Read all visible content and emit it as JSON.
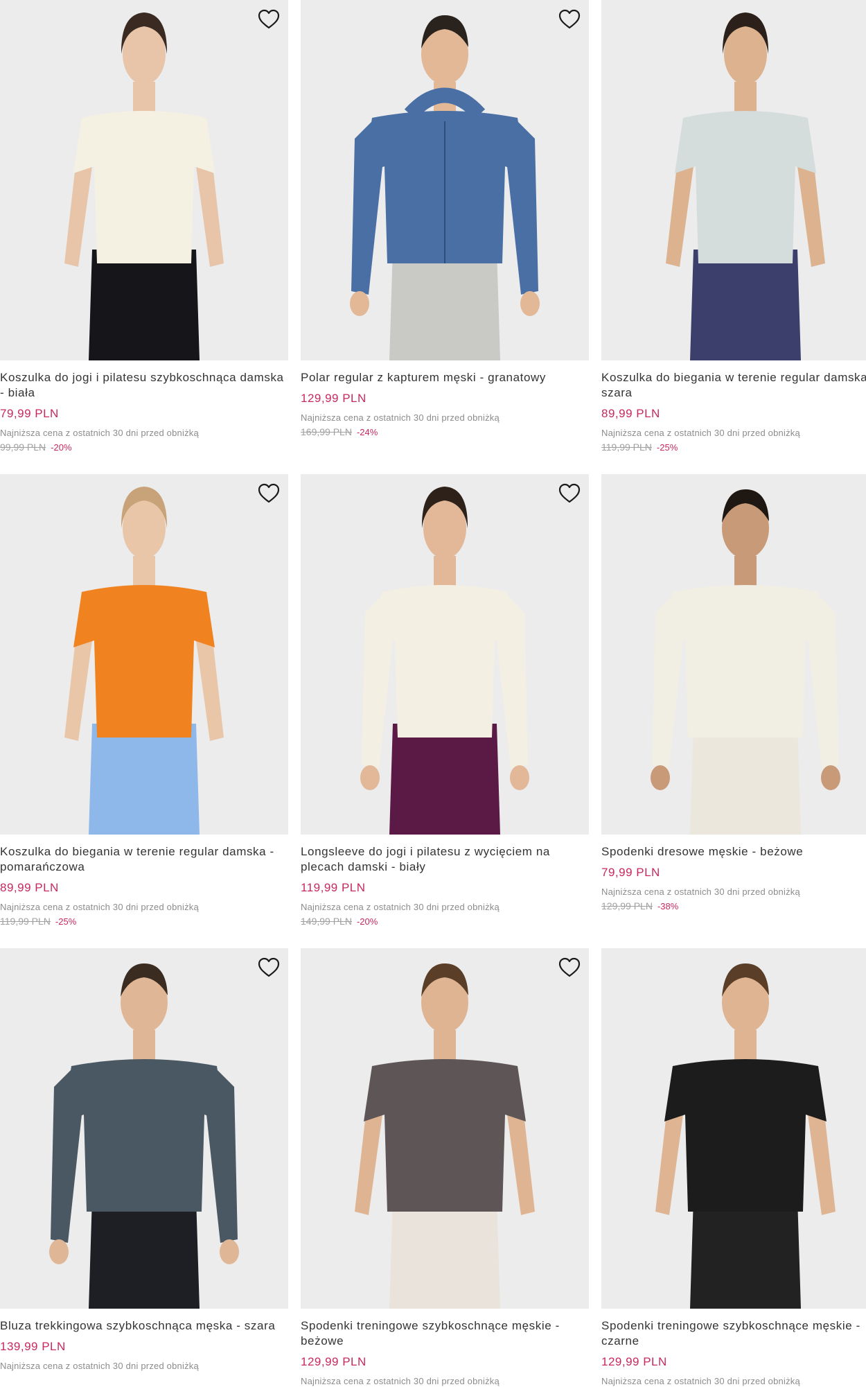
{
  "colors": {
    "price": "#c8285e",
    "image_background": "#ececec",
    "text": "#333333",
    "muted": "#8c8c8c"
  },
  "icons": {
    "favorite": "heart-outline-icon"
  },
  "products": [
    {
      "name": "Koszulka do jogi i pilatesu szybkoschnąca damska - biała",
      "price": "79,99 PLN",
      "lowest_label": "Najniższa cena z ostatnich 30 dni przed obniżką",
      "old_price": "99,99 PLN",
      "discount": "-20%",
      "look": {
        "top": "#f5f1e2",
        "bottom": "#15151a",
        "skin": "#e8c4a8",
        "hair": "#3a2a22",
        "sleeve": "short",
        "gender": "f"
      }
    },
    {
      "name": "Polar regular z kapturem męski - granatowy",
      "price": "129,99 PLN",
      "lowest_label": "Najniższa cena z ostatnich 30 dni przed obniżką",
      "old_price": "169,99 PLN",
      "discount": "-24%",
      "look": {
        "top": "#4a6fa5",
        "bottom": "#c9c9c6",
        "skin": "#e2b896",
        "hair": "#2a221c",
        "sleeve": "hoodie",
        "gender": "m"
      }
    },
    {
      "name": "Koszulka do biegania w terenie regular damska - szara",
      "price": "89,99 PLN",
      "lowest_label": "Najniższa cena z ostatnich 30 dni przed obniżką",
      "old_price": "119,99 PLN",
      "discount": "-25%",
      "look": {
        "top": "#d5dcdc",
        "bottom": "#3c3f6b",
        "skin": "#dcb28f",
        "hair": "#2c211a",
        "sleeve": "short",
        "gender": "f"
      }
    },
    {
      "name": "Koszulka do biegania w terenie regular damska - pomarańczowa",
      "price": "89,99 PLN",
      "lowest_label": "Najniższa cena z ostatnich 30 dni przed obniżką",
      "old_price": "119,99 PLN",
      "discount": "-25%",
      "look": {
        "top": "#f0821f",
        "bottom": "#8fb8ea",
        "skin": "#eac6a8",
        "hair": "#c8a37a",
        "sleeve": "short",
        "gender": "f"
      }
    },
    {
      "name": "Longsleeve do jogi i pilatesu z wycięciem na plecach damski - biały",
      "price": "119,99 PLN",
      "lowest_label": "Najniższa cena z ostatnich 30 dni przed obniżką",
      "old_price": "149,99 PLN",
      "discount": "-20%",
      "look": {
        "top": "#f3efe2",
        "bottom": "#5b1a45",
        "skin": "#e2b898",
        "hair": "#2e2119",
        "sleeve": "long",
        "gender": "f"
      }
    },
    {
      "name": "Spodenki dresowe męskie - beżowe",
      "price": "79,99 PLN",
      "lowest_label": "Najniższa cena z ostatnich 30 dni przed obniżką",
      "old_price": "129,99 PLN",
      "discount": "-38%",
      "look": {
        "top": "#f1eee3",
        "bottom": "#ebe7dc",
        "skin": "#c99a78",
        "hair": "#1e1712",
        "sleeve": "long",
        "gender": "m"
      }
    },
    {
      "name": "Bluza trekkingowa szybkoschnąca męska - szara",
      "price": "139,99 PLN",
      "lowest_label": "Najniższa cena z ostatnich 30 dni przed obniżką",
      "old_price": "",
      "discount": "",
      "look": {
        "top": "#4a5863",
        "bottom": "#1d1f24",
        "skin": "#e0b796",
        "hair": "#3a2c20",
        "sleeve": "long",
        "gender": "m"
      }
    },
    {
      "name": "Spodenki treningowe szybkoschnące męskie - beżowe",
      "price": "129,99 PLN",
      "lowest_label": "Najniższa cena z ostatnich 30 dni przed obniżką",
      "old_price": "",
      "discount": "",
      "look": {
        "top": "#5e5556",
        "bottom": "#e9e3dc",
        "skin": "#dfb493",
        "hair": "#5a3e28",
        "sleeve": "short",
        "gender": "m"
      }
    },
    {
      "name": "Spodenki treningowe szybkoschnące męskie - czarne",
      "price": "129,99 PLN",
      "lowest_label": "Najniższa cena z ostatnich 30 dni przed obniżką",
      "old_price": "",
      "discount": "",
      "look": {
        "top": "#1c1c1c",
        "bottom": "#222222",
        "skin": "#dfb493",
        "hair": "#5a3e28",
        "sleeve": "short",
        "gender": "m"
      }
    }
  ]
}
